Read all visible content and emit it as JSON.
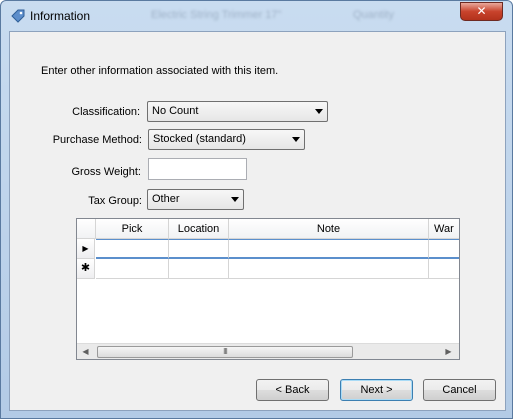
{
  "window": {
    "title": "Information",
    "ghost_title_fragments": [
      "Electric String Trimmer 17\"",
      "Quantity"
    ],
    "close_glyph": "✕",
    "icon": "tag-icon"
  },
  "intro_text": "Enter other information associated with this item.",
  "fields": {
    "classification": {
      "label": "Classification:",
      "value": "No Count"
    },
    "purchase_method": {
      "label": "Purchase Method:",
      "value": "Stocked (standard)"
    },
    "gross_weight": {
      "label": "Gross Weight:",
      "value": ""
    },
    "tax_group": {
      "label": "Tax Group:",
      "value": "Other"
    }
  },
  "grid": {
    "columns": [
      "Pick",
      "Location",
      "Note",
      "War"
    ],
    "rows": [
      {
        "indicator": "▶",
        "cells": [
          "",
          "",
          "",
          ""
        ]
      },
      {
        "indicator": "✱",
        "cells": [
          "",
          "",
          "",
          ""
        ]
      }
    ],
    "scroll_left": "◀",
    "scroll_right": "▶",
    "thumb_grip": "III"
  },
  "buttons": {
    "back": "< Back",
    "next": "Next >",
    "cancel": "Cancel"
  }
}
